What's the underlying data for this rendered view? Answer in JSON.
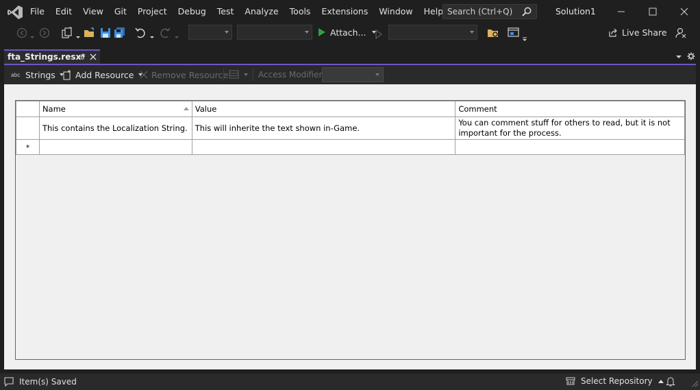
{
  "menu": [
    "File",
    "Edit",
    "View",
    "Git",
    "Project",
    "Debug",
    "Test",
    "Analyze",
    "Tools",
    "Extensions",
    "Window",
    "Help"
  ],
  "search": {
    "placeholder": "Search (Ctrl+Q)"
  },
  "solution": {
    "name": "Solution1"
  },
  "toolbar": {
    "attach_label": "Attach...",
    "live_share_label": "Live Share"
  },
  "doc_tab": {
    "title": "fta_Strings.resx*"
  },
  "resource_toolbar": {
    "strings_label": "Strings",
    "add_resource_label": "Add Resource",
    "remove_resource_label": "Remove Resource",
    "access_modifier_label": "Access Modifier:"
  },
  "grid": {
    "columns": [
      "Name",
      "Value",
      "Comment"
    ],
    "rows": [
      {
        "name": "This contains the Localization String.",
        "value": "This will inherite the text shown in-Game.",
        "comment": "You can comment stuff for others to read, but it is not important for the process."
      }
    ],
    "new_row_marker": "*"
  },
  "status": {
    "message": "Item(s) Saved",
    "select_repository_label": "Select Repository"
  },
  "colors": {
    "accent": "#6f55c7",
    "chrome_bg": "#1f1f1f",
    "editor_bg": "#f0f0f0",
    "play_green": "#2ea043"
  }
}
